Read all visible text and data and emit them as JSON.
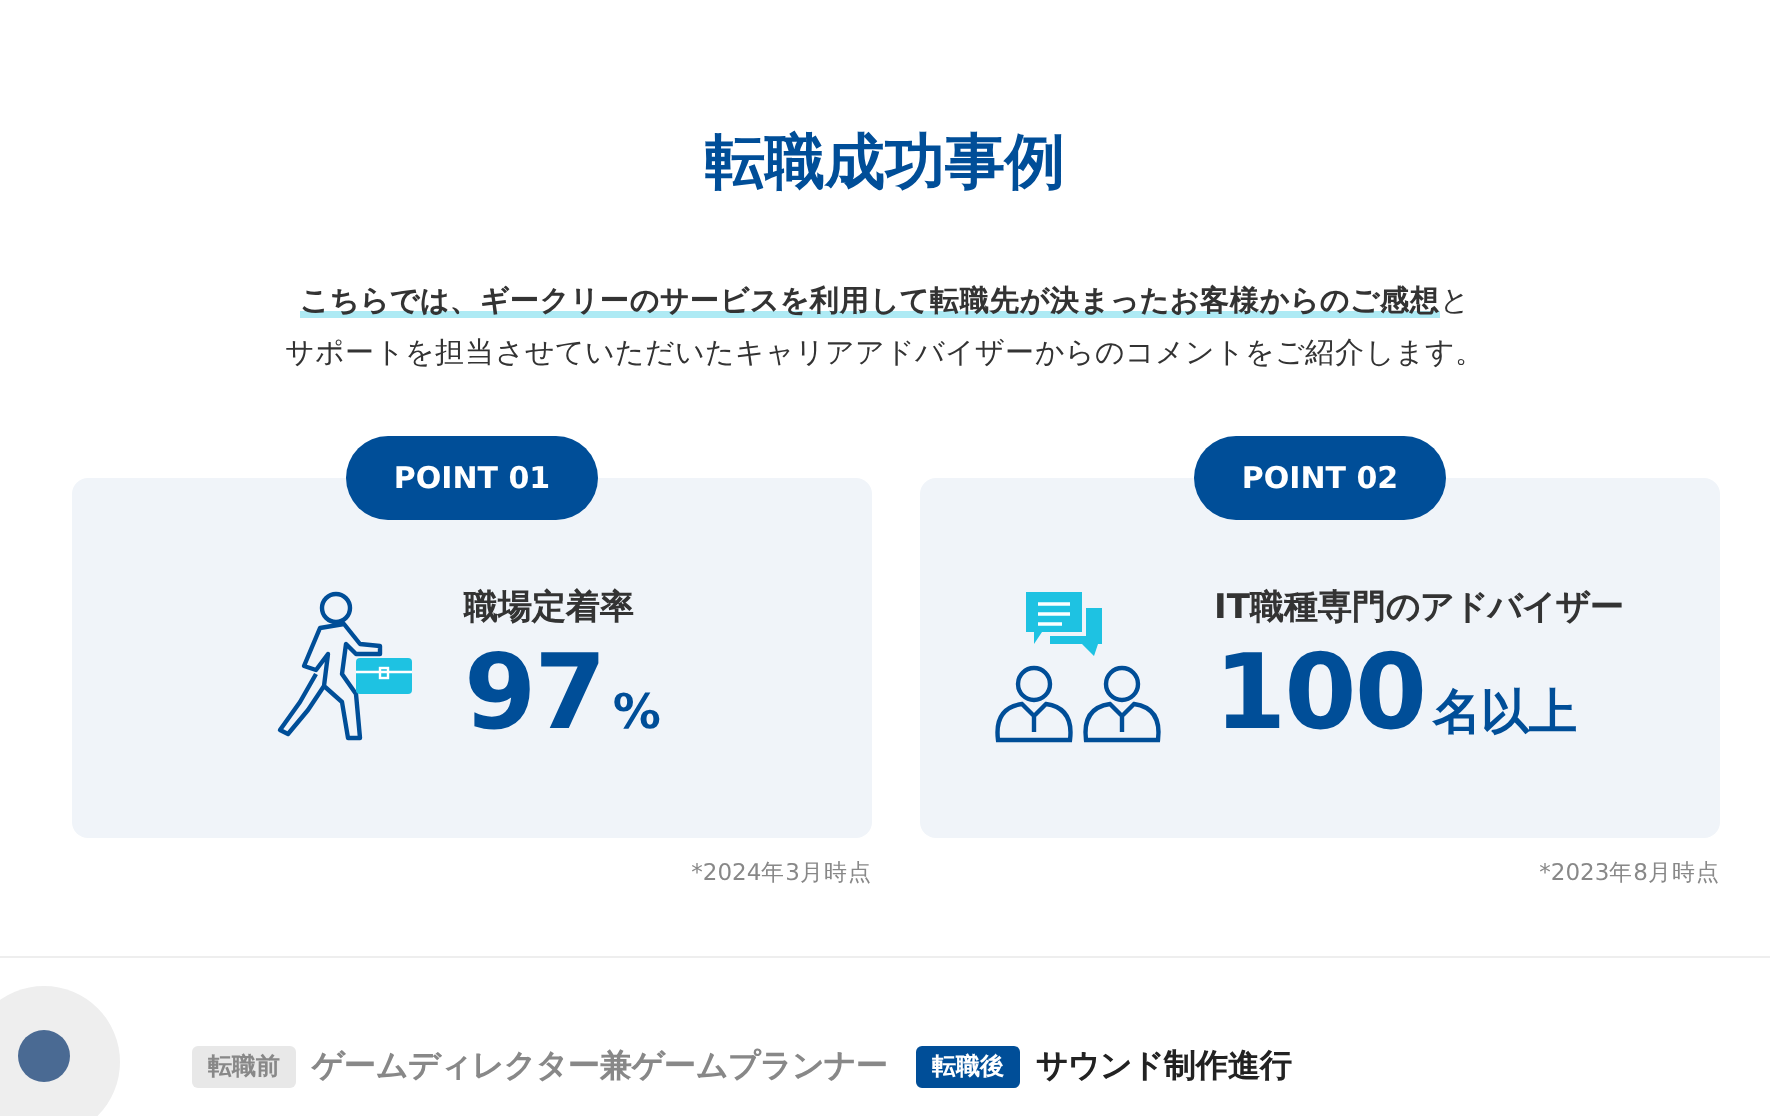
{
  "title": "転職成功事例",
  "intro": [
    "**こちらでは、ギークリーのサービスを利用して転職先が決まったお客様からのご感想**と",
    "サポートを担当させていただいたキャリアアドバイザーからのコメントをご紹介します。"
  ],
  "points": [
    {
      "kind": "retention",
      "badge": "POINT 01",
      "label": "職場定着率",
      "value": "97",
      "unit": "%",
      "note": "*2024年3月時点"
    },
    {
      "kind": "advisors",
      "badge": "POINT 02",
      "label": "IT職種専門のアドバイザー",
      "value": "100",
      "unit": "名以上",
      "note": "*2023年8月時点"
    }
  ],
  "case": {
    "before_tag": "転職前",
    "before": "ゲームディレクター兼ゲームプランナー",
    "after_tag": "転職後",
    "after": "サウンド制作進行"
  }
}
